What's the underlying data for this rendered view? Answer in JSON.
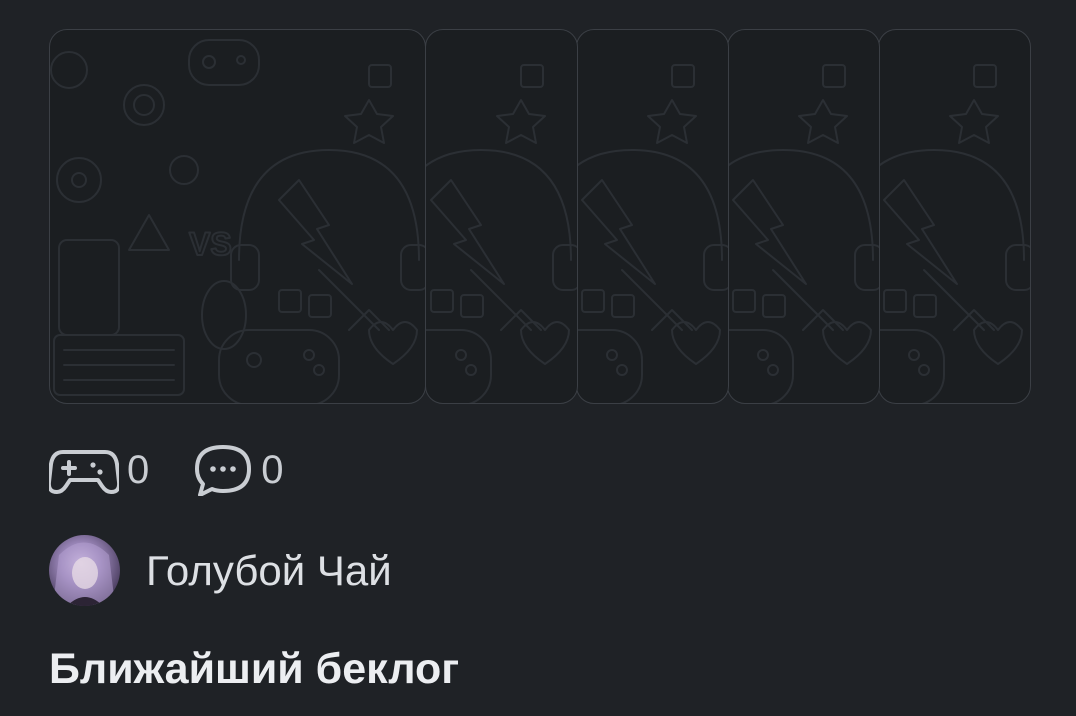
{
  "post": {
    "likes_count": "0",
    "comments_count": "0",
    "author_name": "Голубой Чай",
    "title": "Ближайший беклог"
  },
  "icons": {
    "likes": "gamepad-icon",
    "comments": "chat-bubble-icon"
  },
  "colors": {
    "background": "#1f2226",
    "card_border": "#3b3f45",
    "text": "#e8eaed"
  }
}
